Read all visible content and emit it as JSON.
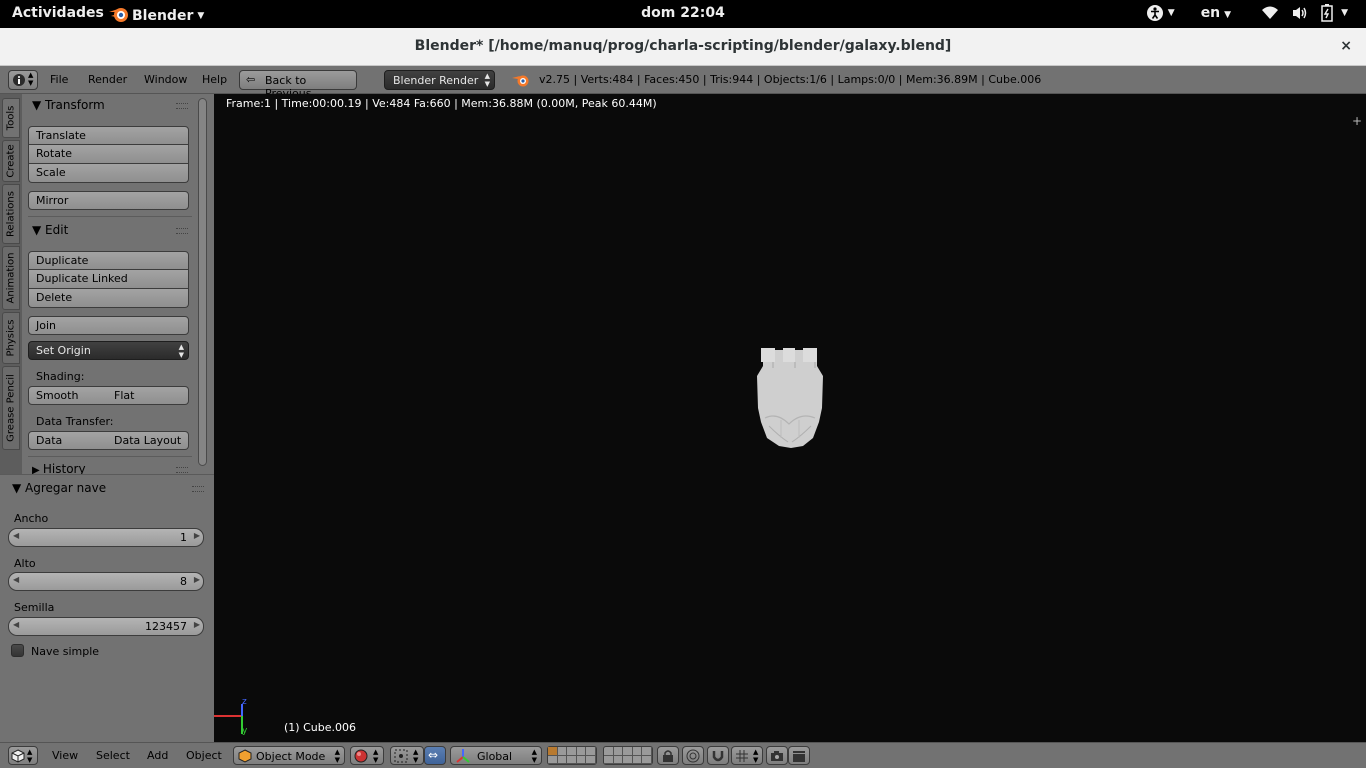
{
  "gnome": {
    "activities": "Actividades",
    "app_name": "Blender",
    "clock": "dom 22:04",
    "language": "en"
  },
  "window": {
    "title": "Blender* [/home/manuq/prog/charla-scripting/blender/galaxy.blend]",
    "close": "×"
  },
  "info_header": {
    "menus": [
      "File",
      "Render",
      "Window",
      "Help"
    ],
    "back_button": "Back to Previous",
    "render_engine": "Blender Render",
    "stats": "v2.75 | Verts:484 | Faces:450 | Tris:944 | Objects:1/6 | Lamps:0/0 | Mem:36.89M | Cube.006"
  },
  "tabs": [
    "Tools",
    "Create",
    "Relations",
    "Animation",
    "Physics",
    "Grease Pencil"
  ],
  "toolshelf": {
    "transform": {
      "title": "Transform",
      "translate": "Translate",
      "rotate": "Rotate",
      "scale": "Scale",
      "mirror": "Mirror"
    },
    "edit": {
      "title": "Edit",
      "duplicate": "Duplicate",
      "duplicate_linked": "Duplicate Linked",
      "delete": "Delete",
      "join": "Join",
      "set_origin": "Set Origin",
      "shading_label": "Shading:",
      "smooth": "Smooth",
      "flat": "Flat",
      "data_transfer_label": "Data Transfer:",
      "data": "Data",
      "data_layout": "Data Layout"
    },
    "history": {
      "title": "History"
    }
  },
  "redo_panel": {
    "title": "Agregar nave",
    "ancho_label": "Ancho",
    "ancho_value": "1",
    "alto_label": "Alto",
    "alto_value": "8",
    "semilla_label": "Semilla",
    "semilla_value": "123457",
    "nave_simple_label": "Nave simple",
    "nave_simple_checked": false
  },
  "viewport": {
    "info": "Frame:1 | Time:00:00.19 | Ve:484 Fa:660 | Mem:36.88M (0.00M, Peak 60.44M)",
    "active_object": "(1) Cube.006",
    "axis_z": "z",
    "axis_y": "y"
  },
  "view_header": {
    "menus": [
      "View",
      "Select",
      "Add",
      "Object"
    ],
    "mode": "Object Mode",
    "orientation": "Global"
  },
  "colors": {
    "ui_gray": "#727272",
    "viewport_bg": "#0a0a0a",
    "mesh": "#cfcfcf",
    "axis_x": "#d33",
    "axis_z": "#46f",
    "axis_y": "#3c3",
    "blender_orange": "#f5792a"
  }
}
